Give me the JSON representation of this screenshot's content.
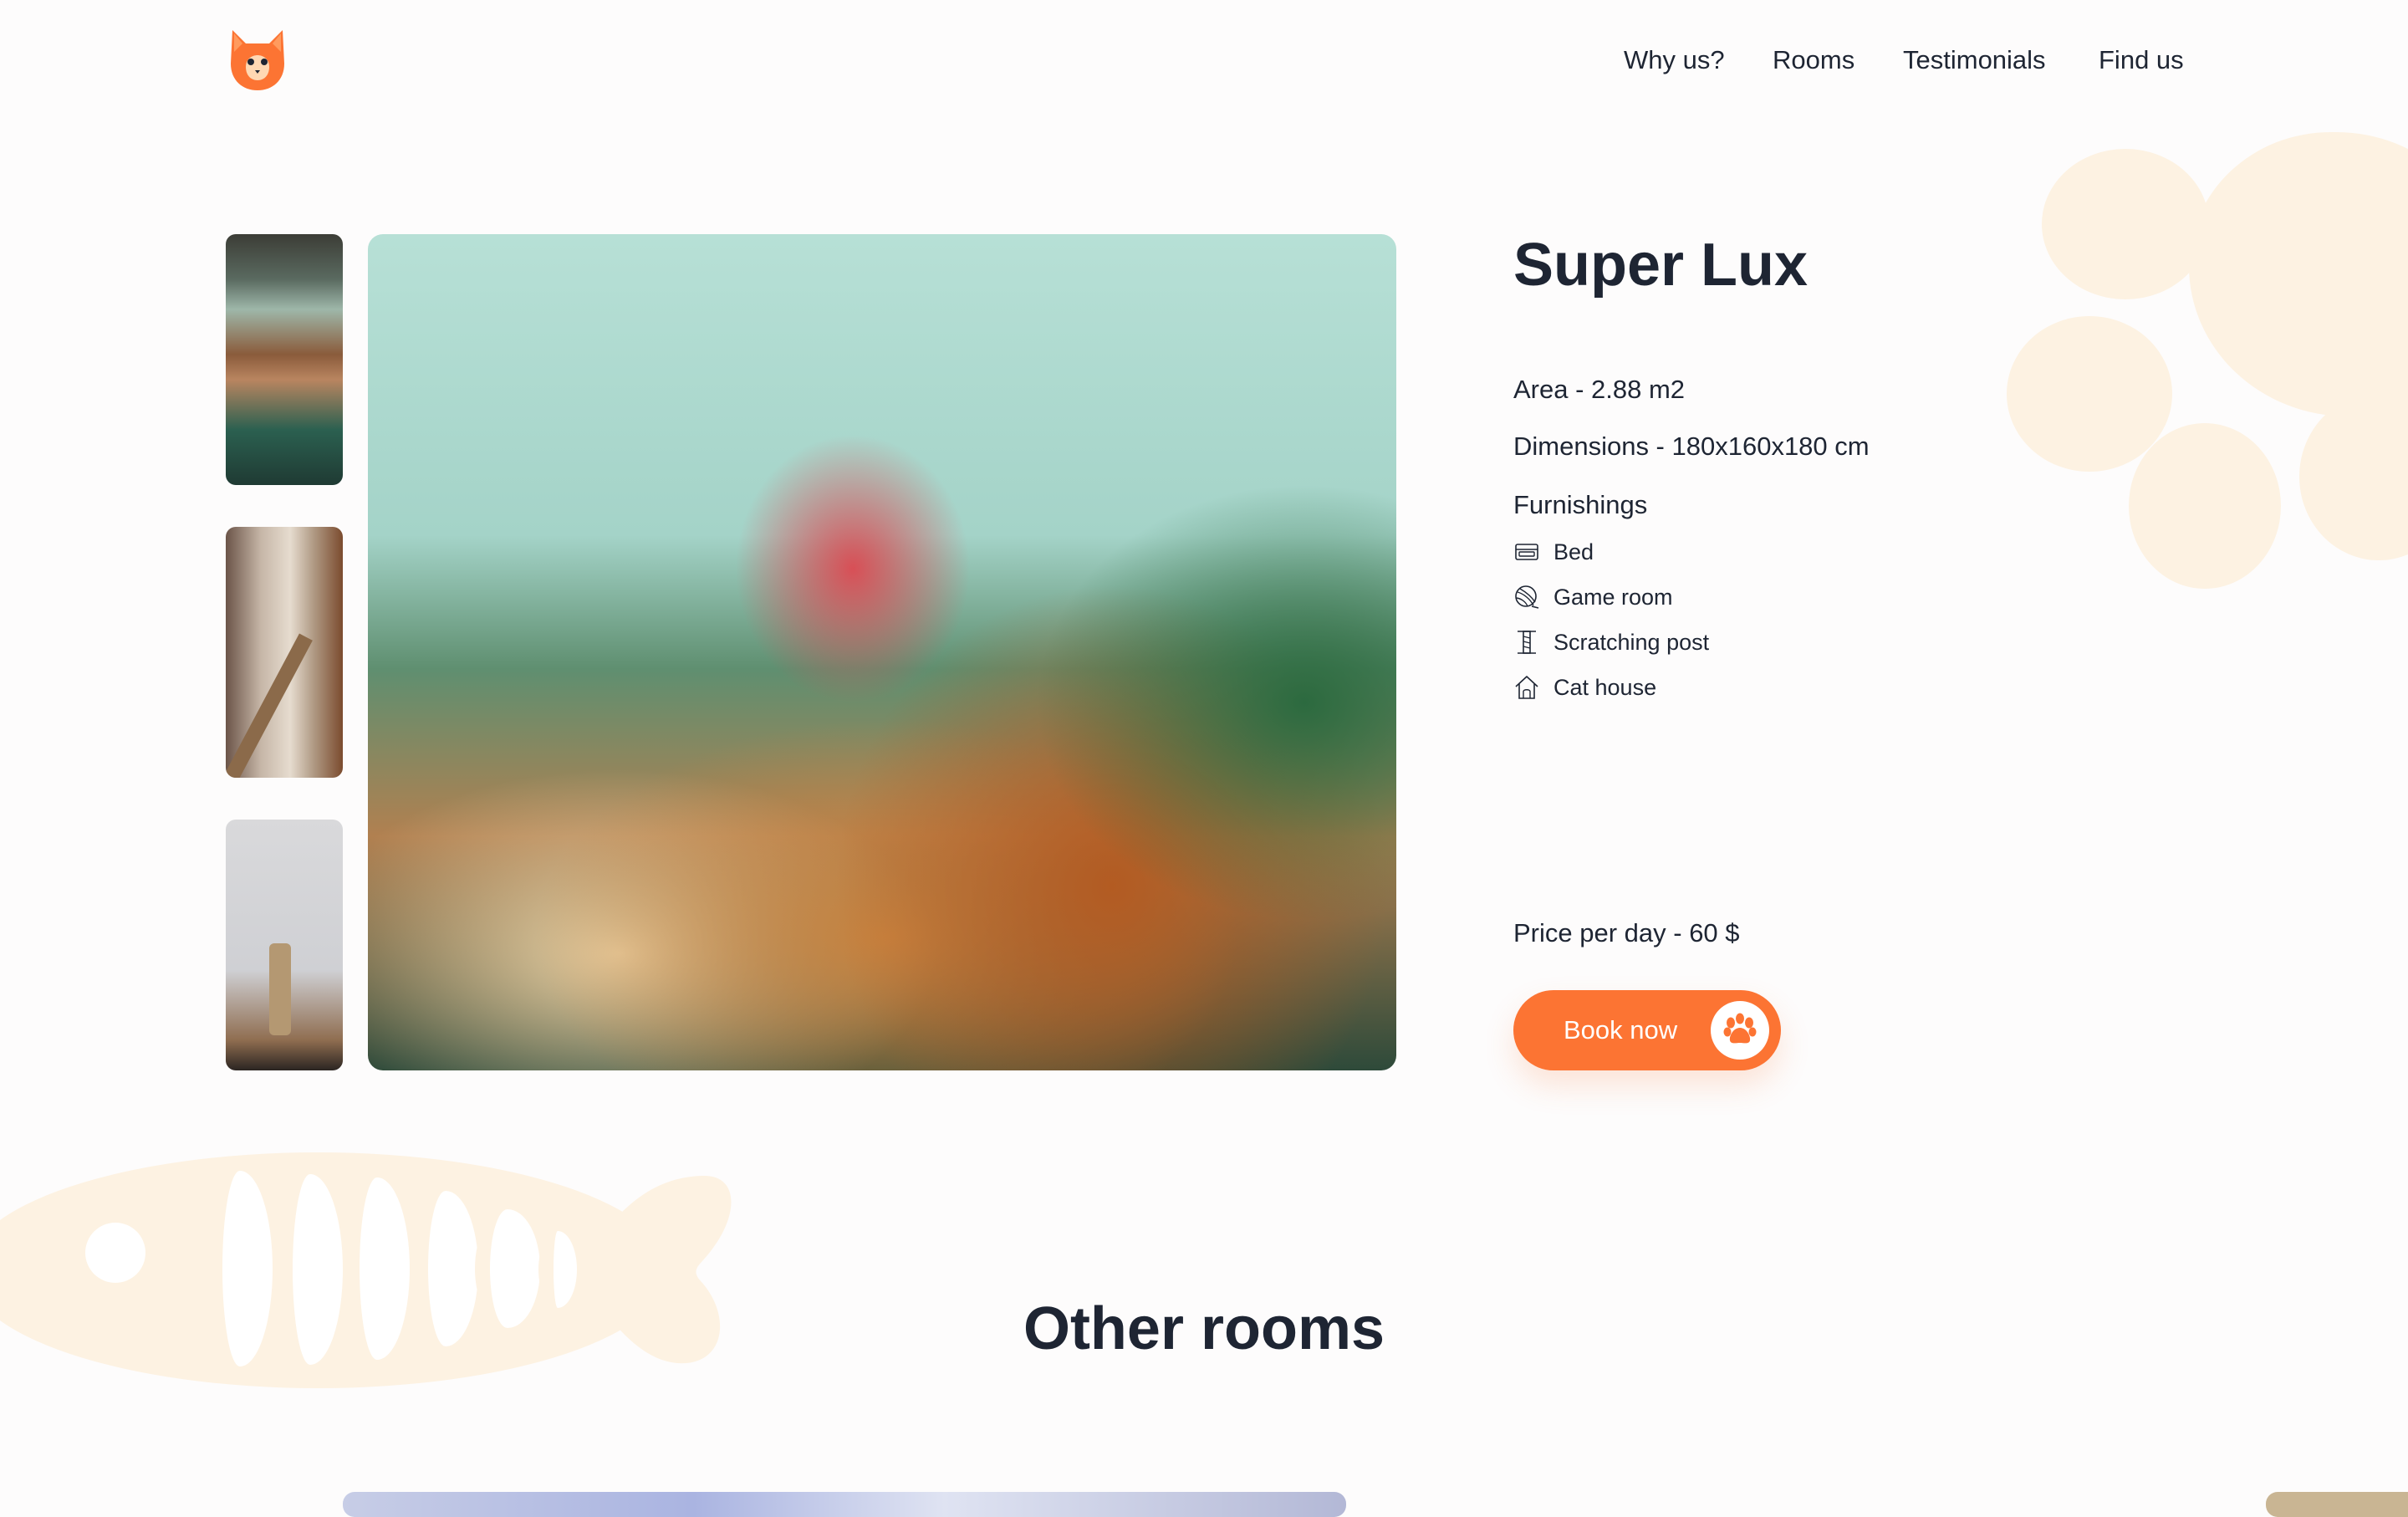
{
  "nav": {
    "links": [
      "Why us?",
      "Rooms",
      "Testimonials",
      "Find us"
    ]
  },
  "room": {
    "title": "Super Lux",
    "area": "Area - 2.88 m2",
    "dimensions": "Dimensions - 180x160x180 cm",
    "furnishings_heading": "Furnishings",
    "furnishings": [
      {
        "label": "Bed",
        "icon": "bed-icon"
      },
      {
        "label": "Game room",
        "icon": "yarn-ball-icon"
      },
      {
        "label": "Scratching post",
        "icon": "scratching-post-icon"
      },
      {
        "label": "Cat house",
        "icon": "house-icon"
      }
    ],
    "price": "Price per day - 60 $",
    "book_label": "Book now"
  },
  "other_rooms": {
    "title": "Other rooms"
  },
  "colors": {
    "accent": "#fc7433",
    "text": "#1e2533",
    "background": "#fdfcfc",
    "decor": "#fdf2e2"
  }
}
